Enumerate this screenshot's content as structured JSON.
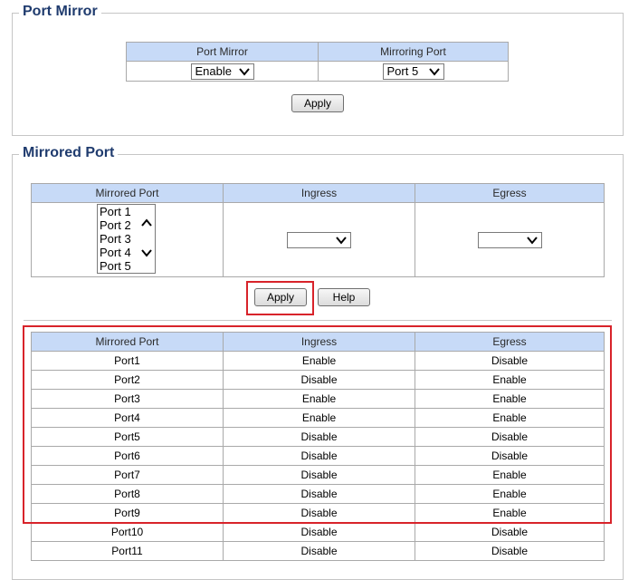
{
  "port_mirror": {
    "title": "Port Mirror",
    "col_port_mirror": "Port Mirror",
    "col_mirroring_port": "Mirroring Port",
    "port_mirror_value": "Enable",
    "mirroring_port_value": "Port 5",
    "apply_label": "Apply"
  },
  "mirrored_port": {
    "title": "Mirrored Port",
    "col_mirrored_port": "Mirrored Port",
    "col_ingress": "Ingress",
    "col_egress": "Egress",
    "port_list": [
      "Port 1",
      "Port 2",
      "Port 3",
      "Port 4",
      "Port 5"
    ],
    "ingress_value": "",
    "egress_value": "",
    "apply_label": "Apply",
    "help_label": "Help"
  },
  "status_table": {
    "headers": [
      "Mirrored Port",
      "Ingress",
      "Egress"
    ],
    "rows": [
      [
        "Port1",
        "Enable",
        "Disable"
      ],
      [
        "Port2",
        "Disable",
        "Enable"
      ],
      [
        "Port3",
        "Enable",
        "Enable"
      ],
      [
        "Port4",
        "Enable",
        "Enable"
      ],
      [
        "Port5",
        "Disable",
        "Disable"
      ],
      [
        "Port6",
        "Disable",
        "Disable"
      ],
      [
        "Port7",
        "Disable",
        "Enable"
      ],
      [
        "Port8",
        "Disable",
        "Enable"
      ],
      [
        "Port9",
        "Disable",
        "Enable"
      ],
      [
        "Port10",
        "Disable",
        "Disable"
      ],
      [
        "Port11",
        "Disable",
        "Disable"
      ]
    ]
  },
  "colors": {
    "header_bg": "#c7daf7",
    "title": "#1f3b6e",
    "highlight": "#d8232a"
  }
}
